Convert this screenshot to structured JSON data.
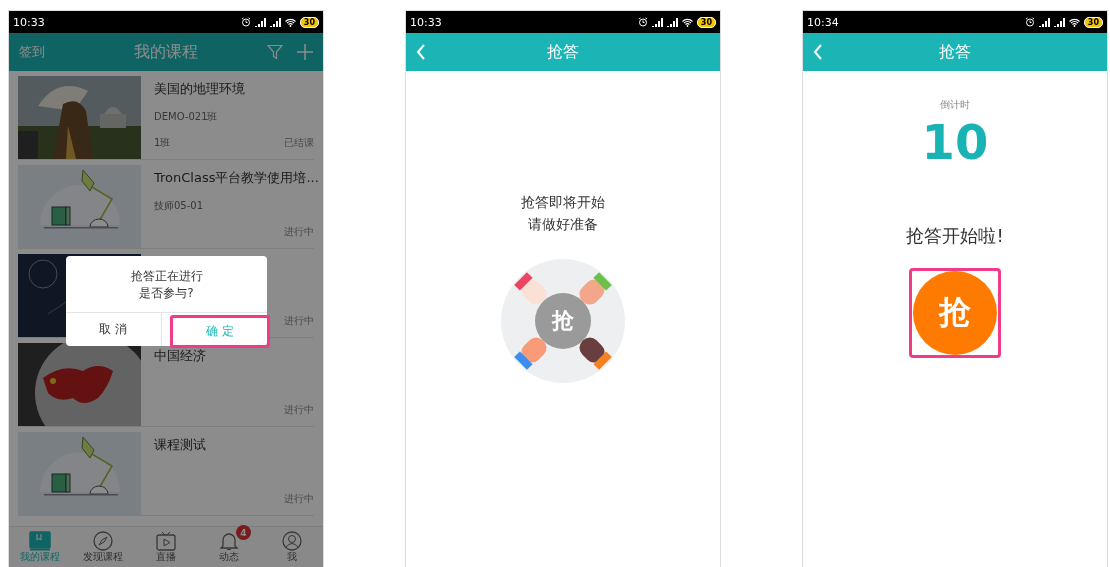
{
  "screens": [
    {
      "kind": "course_list",
      "dimmed": true,
      "status_bar": {
        "time": "10:33",
        "battery": "30"
      },
      "header": {
        "back": false,
        "action": "签到",
        "title": "我的课程"
      },
      "courses": [
        {
          "kind": "picture",
          "title": "美国的地理环境",
          "class": "DEMO-021班",
          "section": "1班",
          "status": "已结课"
        },
        {
          "kind": "illustration",
          "title": "TronClass平台教学使用培...",
          "class": "技师05-01",
          "status": "进行中"
        },
        {
          "kind": "picture",
          "status": "进行中"
        },
        {
          "kind": "picture",
          "title": "中国经济",
          "status": "进行中"
        },
        {
          "kind": "illustration",
          "title": "课程测试",
          "status": "进行中"
        }
      ],
      "dialog": {
        "lines": [
          "抢答正在进行",
          "是否参与?"
        ],
        "buttons": [
          {
            "kind": "cancel",
            "label": "取 消",
            "highlighted": false
          },
          {
            "kind": "confirm",
            "label": "确 定",
            "highlighted": true
          }
        ]
      },
      "tabs": [
        {
          "label": "我的课程",
          "selected": true
        },
        {
          "label": "发现课程",
          "selected": false
        },
        {
          "label": "直播",
          "selected": false
        },
        {
          "label": "动态",
          "selected": false,
          "badge": "4"
        },
        {
          "label": "我",
          "selected": false
        }
      ]
    },
    {
      "kind": "waiting",
      "status_bar": {
        "time": "10:33",
        "battery": "30"
      },
      "header": {
        "back": true,
        "title": "抢答"
      },
      "message": [
        "抢答即将开始",
        "请做好准备"
      ],
      "emblem": "抢"
    },
    {
      "kind": "started",
      "status_bar": {
        "time": "10:34",
        "battery": "30"
      },
      "header": {
        "back": true,
        "title": "抢答"
      },
      "countdown_label": "倒计时",
      "countdown": "10",
      "message": "抢答开始啦!",
      "grab_button": {
        "label": "抢",
        "highlighted": true
      }
    }
  ]
}
